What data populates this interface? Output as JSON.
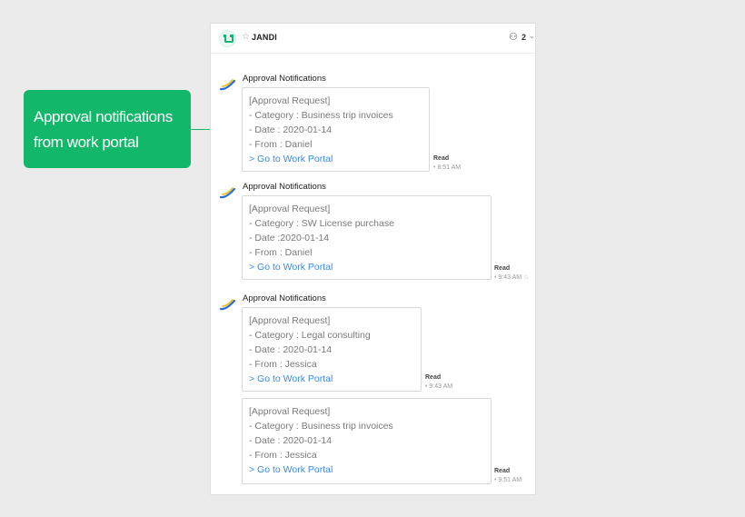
{
  "callout": {
    "line1": "Approval notifications",
    "line2": "from work portal"
  },
  "header": {
    "title": "JANDI",
    "member_count": "2"
  },
  "messages": [
    {
      "sender": "Approval Notifications",
      "lines": [
        "[Approval Request]",
        "- Category : Business trip invoices",
        "- Date : 2020-01-14",
        "- From : Daniel"
      ],
      "link": "> Go to Work Portal",
      "read": "Read",
      "time": "8:51 AM"
    },
    {
      "sender": "Approval Notifications",
      "lines": [
        "[Approval Request]",
        "- Category : SW License purchase",
        "- Date :2020-01-14",
        "- From : Daniel"
      ],
      "link": "> Go to Work Portal",
      "read": "Read",
      "time": "9:43 AM"
    },
    {
      "sender": "Approval Notifications",
      "lines": [
        "[Approval Request]",
        "- Category : Legal consulting",
        "- Date : 2020-01-14",
        "- From : Jessica"
      ],
      "link": "> Go to Work Portal",
      "read": "Read",
      "time": "9:43 AM"
    },
    {
      "sender": "",
      "lines": [
        "[Approval Request]",
        "- Category : Business trip invoices",
        "- Date : 2020-01-14",
        "- From : Jessica"
      ],
      "link": "> Go to Work Portal",
      "read": "Read",
      "time": "9:51 AM"
    }
  ],
  "colors": {
    "accent_green": "#12b76a",
    "link_blue": "#3b8ae6"
  },
  "icons": [
    "room-icon",
    "star-icon",
    "members-icon",
    "chevron-down-icon",
    "bot-avatar-icon"
  ]
}
